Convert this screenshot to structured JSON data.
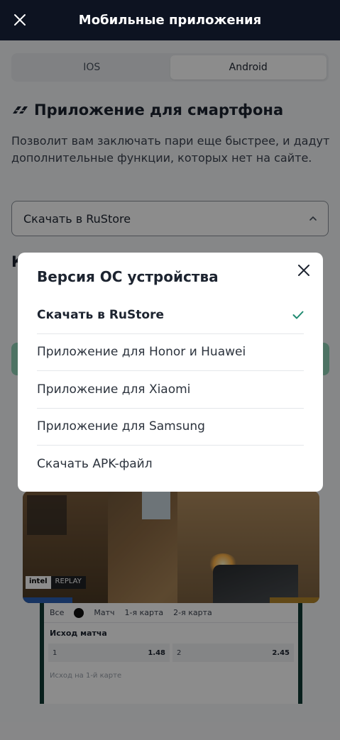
{
  "header": {
    "title": "Мобильные приложения",
    "close_icon": "close-icon"
  },
  "platform_tabs": [
    {
      "label": "IOS",
      "active": false
    },
    {
      "label": "Android",
      "active": true
    }
  ],
  "section": {
    "title": "Приложение для смартфона",
    "description": "Позволит вам заключать пари еще быстрее, и дадут дополнительные функции, которых нет на сайте.",
    "select_value": "Скачать в RuStore",
    "partial_heading": "К"
  },
  "mockup": {
    "badge_brand": "intel",
    "badge_label": "REPLAY",
    "tabs": [
      "Все",
      "Матч",
      "1-я карта",
      "2-я карта"
    ],
    "market_title": "Исход матча",
    "odds": [
      {
        "side": "1",
        "value": "1.48"
      },
      {
        "side": "2",
        "value": "2.45"
      }
    ],
    "next_market": "Исход на 1-й карте"
  },
  "modal": {
    "title": "Версия ОС устройства",
    "options": [
      {
        "label": "Скачать в RuStore",
        "selected": true
      },
      {
        "label": "Приложение для Honor и Huawei",
        "selected": false
      },
      {
        "label": "Приложение для Xiaomi",
        "selected": false
      },
      {
        "label": "Приложение для Samsung",
        "selected": false
      },
      {
        "label": "Скачать APK-файл",
        "selected": false
      }
    ]
  },
  "colors": {
    "header_bg": "#0d1321",
    "accent_check": "#1f8a70",
    "overlay": "rgba(0,0,0,0.45)"
  }
}
